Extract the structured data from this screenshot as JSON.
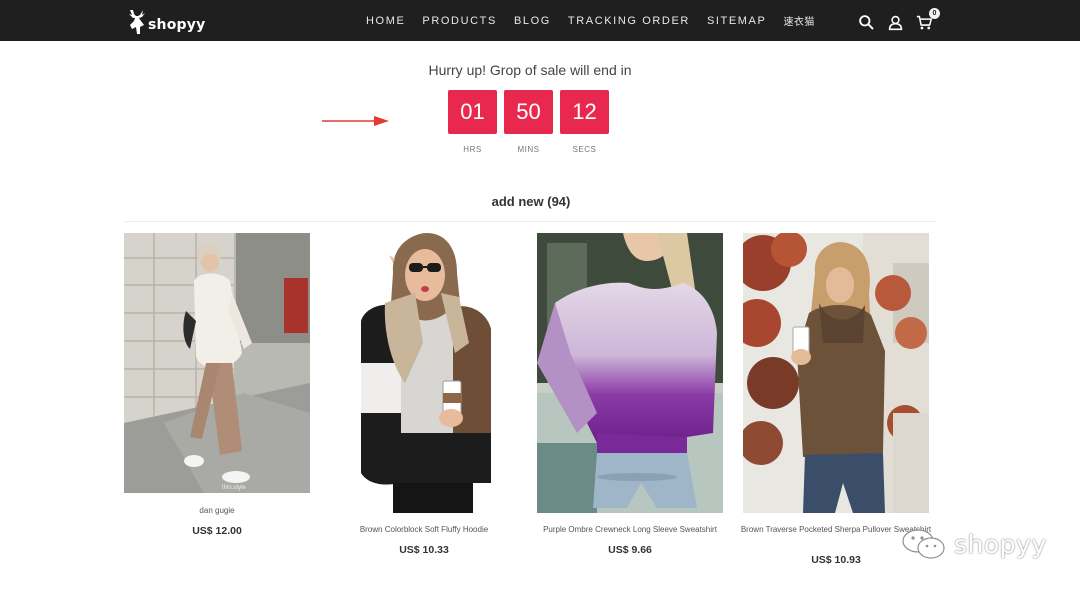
{
  "brand": {
    "name": "shopyy"
  },
  "nav": {
    "items": [
      {
        "label": "HOME"
      },
      {
        "label": "PRODUCTS"
      },
      {
        "label": "BLOG"
      },
      {
        "label": "TRACKING ORDER"
      },
      {
        "label": "SITEMAP"
      },
      {
        "label": "速衣猫"
      }
    ]
  },
  "header_tools": {
    "search_icon": "search-icon",
    "account_icon": "user-icon",
    "cart_icon": "cart-icon",
    "cart_count": "0"
  },
  "countdown": {
    "title": "Hurry up! Grop of sale will end in",
    "hours": "01",
    "minutes": "50",
    "seconds": "12",
    "hours_label": "HRS",
    "minutes_label": "MINS",
    "seconds_label": "SECS",
    "accent": "#e8284f"
  },
  "section": {
    "title": "add new (94)"
  },
  "products": [
    {
      "name": "dan gugie",
      "price": "US$ 12.00"
    },
    {
      "name": "Brown Colorblock Soft Fluffy Hoodie",
      "price": "US$ 10.33"
    },
    {
      "name": "Purple Ombre Crewneck Long Sleeve Sweatshirt",
      "price": "US$ 9.66"
    },
    {
      "name": "Brown Traverse Pocketed Sherpa Pullover Sweatshirt",
      "price": "US$ 10.93"
    }
  ],
  "watermark": {
    "text": "shopyy"
  },
  "colors": {
    "topbar": "#1f1f1f",
    "accent": "#e8284f",
    "arrow": "#e53935"
  }
}
